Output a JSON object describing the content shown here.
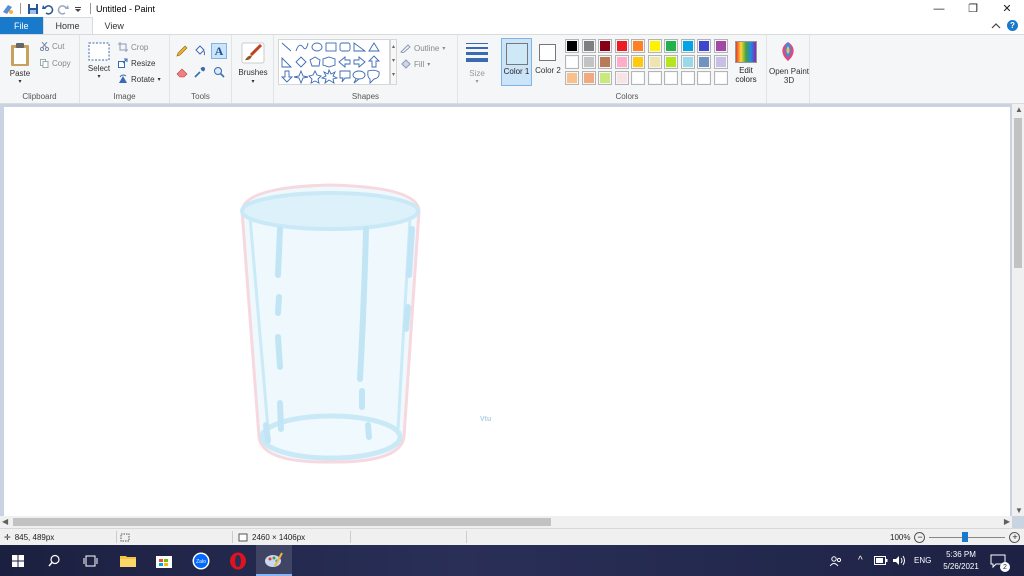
{
  "window": {
    "title": "Untitled - Paint",
    "controls": {
      "minimize": "—",
      "maximize": "❐",
      "close": "✕"
    }
  },
  "menu": {
    "tabs": [
      "File",
      "Home",
      "View"
    ],
    "help": "?"
  },
  "ribbon": {
    "clipboard": {
      "label": "Clipboard",
      "paste": "Paste",
      "cut": "Cut",
      "copy": "Copy"
    },
    "image": {
      "label": "Image",
      "select": "Select",
      "crop": "Crop",
      "resize": "Resize",
      "rotate": "Rotate"
    },
    "tools": {
      "label": "Tools"
    },
    "brushes": {
      "label": "Brushes"
    },
    "shapes": {
      "label": "Shapes",
      "outline": "Outline",
      "fill": "Fill"
    },
    "size": {
      "label": "Size"
    },
    "colors": {
      "label": "Colors",
      "color1": "Color 1",
      "color2": "Color 2",
      "edit_colors": "Edit colors",
      "paint3d": "Open Paint 3D",
      "color1_value": "#cfe8f7",
      "color2_value": "#ffffff",
      "palette_row1": [
        "#000000",
        "#7f7f7f",
        "#880015",
        "#ed1c24",
        "#ff7f27",
        "#fff200",
        "#22b14c",
        "#00a2e8",
        "#3f48cc",
        "#a349a4"
      ],
      "palette_row2": [
        "#ffffff",
        "#c3c3c3",
        "#b97a57",
        "#ffaec9",
        "#ffc90e",
        "#efe4b0",
        "#b5e61d",
        "#99d9ea",
        "#7092be",
        "#c8bfe7"
      ],
      "palette_row3": [
        "#f9c08a",
        "#f2a97e",
        "#c9e97d",
        "#f8e3e6",
        "#ffffff",
        "#ffffff",
        "#ffffff",
        "#ffffff",
        "#ffffff",
        "#ffffff"
      ]
    }
  },
  "canvas": {
    "watermark": "Vtu"
  },
  "status": {
    "cursor_pos": "845, 489px",
    "image_size": "2460 × 1406px",
    "zoom": "100%"
  },
  "taskbar": {
    "clock_time": "5:36 PM",
    "clock_date": "5/26/2021",
    "lang": "ENG",
    "notifications": "2"
  }
}
